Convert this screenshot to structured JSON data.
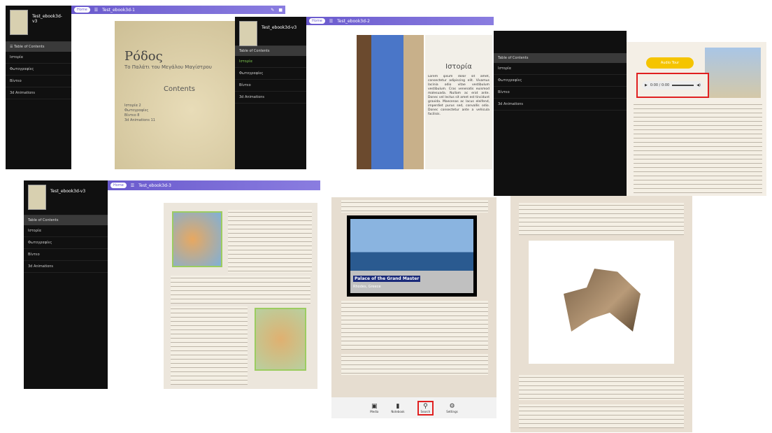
{
  "panel1": {
    "sidebar_title": "Test_ebook3d-v3",
    "toc_items": [
      "Ιστορία",
      "Φωτογραφίες",
      "Βίντεο",
      "3d Animations"
    ]
  },
  "panel2": {
    "home": "Home",
    "page_title": "Test_ebook3d-1",
    "book_title": "Ρόδος",
    "book_subtitle": "Το Παλάτι του Μεγάλου Μαγίστρου",
    "contents": "Contents",
    "contents_items": [
      "Ιστορία 2",
      "Φωτογραφίες",
      "Βίντεο 8",
      "3d Animations 11"
    ]
  },
  "panel3": {
    "sidebar_title": "Test_ebook3d-v3",
    "toc_head": "Table of Contents",
    "toc_items": [
      "Ιστορία",
      "Φωτογραφίες",
      "Βίντεο",
      "3d Animations"
    ]
  },
  "panel4": {
    "home": "Home",
    "page_title": "Test_ebook3d-2",
    "chapter": "Ιστορία"
  },
  "panel5": {
    "toc_head": "Table of Contents",
    "toc_items": [
      "Ιστορία",
      "Φωτογραφίες",
      "Βίντεο",
      "3d Animations"
    ],
    "audio_button": "Audio Tour",
    "audio_time": "0:00 / 0:00"
  },
  "panel6": {
    "sidebar_title": "Test_ebook3d-v3",
    "toc_head": "Table of Contents",
    "toc_items": [
      "Ιστορία",
      "Φωτογραφίες",
      "Βίντεο",
      "3d Animations"
    ],
    "home": "Home",
    "page_title": "Test_ebook3d-3"
  },
  "panel7": {
    "video_title": "Palace of the Grand Master",
    "video_sub": "Rhodes, Greece",
    "toolbar": [
      "Media",
      "Notebook",
      "Search",
      "Settings"
    ]
  },
  "lorem": "Lorem ipsum dolor sit amet, consectetur adipiscing elit. Vivamus lacinia odio vitae vestibulum vestibulum. Cras venenatis euismod malesuada. Nullam ac erat ante. Donec vel lectus sit amet est tincidunt gravida. Maecenas ac lacus eleifend, imperdiet purus sed, convallis odio. Donec consectetur ante a vehicula facilisis."
}
